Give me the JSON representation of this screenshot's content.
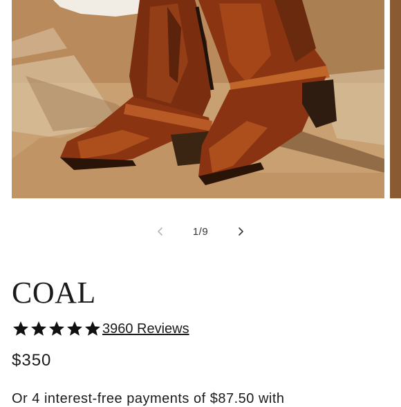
{
  "gallery": {
    "image_alt": "COAL",
    "counter": "1/9",
    "prev_icon": "chevron-left-icon",
    "next_icon": "chevron-right-icon"
  },
  "product": {
    "title": "COAL",
    "rating": 5,
    "star_icon": "star-icon",
    "reviews_label": "3960 Reviews",
    "price": "$350",
    "installments_text": "Or 4 interest-free payments of $87.50 with"
  },
  "colors": {
    "text": "#1a1a1a",
    "leather": "#8b3a14",
    "ground": "#c79a6a"
  }
}
